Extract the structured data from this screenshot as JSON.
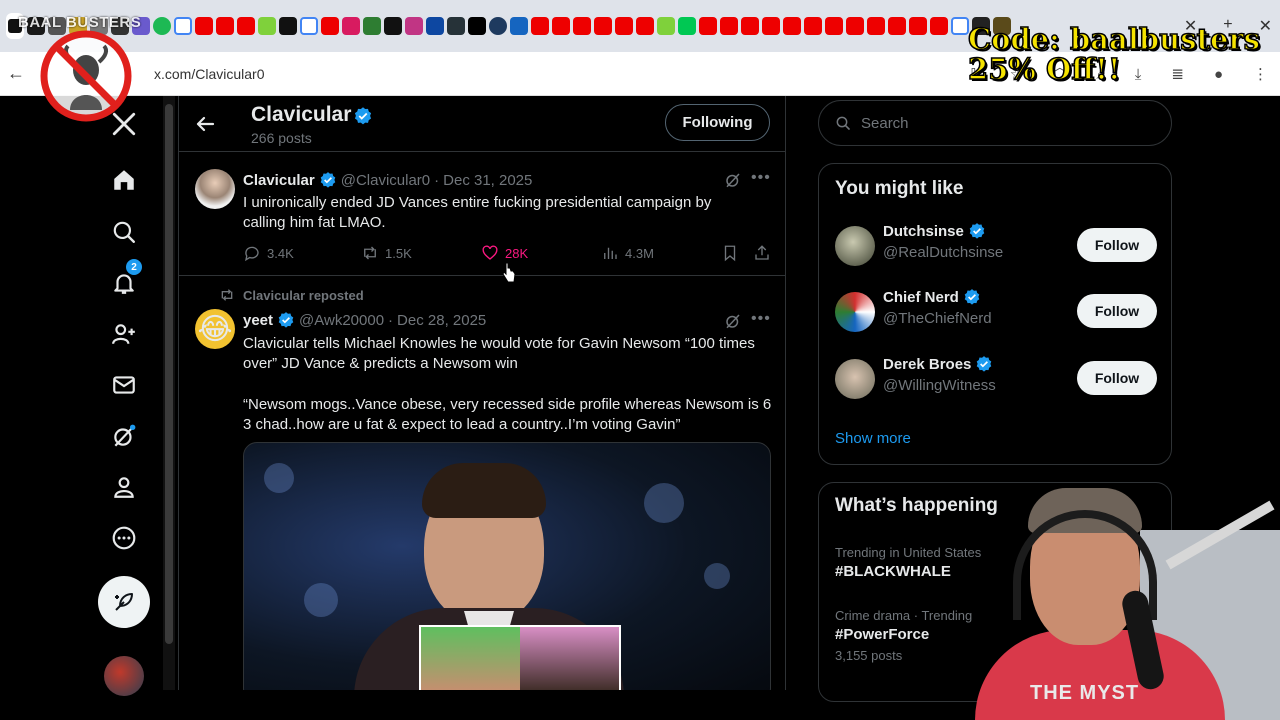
{
  "browser": {
    "url": "x.com/Clavicular0",
    "overlay_caption": "BAAL BUSTERS"
  },
  "promo": {
    "line1": "Code: baalbusters",
    "line2": "25% Off!!"
  },
  "profile": {
    "name": "Clavicular",
    "post_count": "266 posts",
    "following_label": "Following"
  },
  "nav": {
    "notification_count": "2"
  },
  "post1": {
    "name": "Clavicular",
    "handle": "@Clavicular0",
    "date": "Dec 31, 2025",
    "text": "I unironically ended JD Vances entire fucking presidential campaign by calling him fat LMAO.",
    "replies": "3.4K",
    "reposts": "1.5K",
    "likes": "28K",
    "views": "4.3M"
  },
  "post2": {
    "repost_label": "Clavicular reposted",
    "name": "yeet",
    "handle": "@Awk20000",
    "date": "Dec 28, 2025",
    "text_p1": "Clavicular tells Michael Knowles he would vote for Gavin Newsom “100 times over” JD Vance & predicts a Newsom win",
    "text_p2": "“Newsom mogs..Vance obese, very recessed side profile whereas Newsom is 6 3 chad..how are u fat & expect to lead a country..I’m voting Gavin”"
  },
  "search": {
    "placeholder": "Search"
  },
  "you_might_like": {
    "title": "You might like",
    "items": [
      {
        "name": "Dutchsinse",
        "handle": "@RealDutchsinse",
        "button": "Follow"
      },
      {
        "name": "Chief Nerd",
        "handle": "@TheChiefNerd",
        "button": "Follow"
      },
      {
        "name": "Derek Broes",
        "handle": "@WillingWitness",
        "button": "Follow"
      }
    ],
    "show_more": "Show more"
  },
  "whats_happening": {
    "title": "What’s happening",
    "trends": [
      {
        "meta": "Trending in United States",
        "tag": "#BLACKWHALE",
        "count": ""
      },
      {
        "meta": "Crime drama · Trending",
        "tag": "#PowerForce",
        "count": "3,155 posts"
      }
    ]
  },
  "webcam": {
    "shirt_text": "THE MYST"
  },
  "colors": {
    "accent": "#1d9bf0",
    "like": "#f91880",
    "promo": "#f5e300",
    "background": "#000000"
  }
}
